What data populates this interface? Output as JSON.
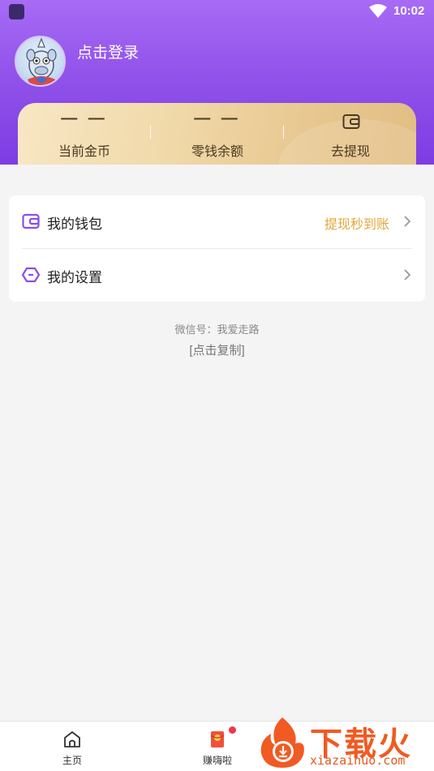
{
  "status_bar": {
    "time": "10:02"
  },
  "profile": {
    "login_text": "点击登录"
  },
  "stats": [
    {
      "value": "— —",
      "label": "当前金币"
    },
    {
      "value": "— —",
      "label": "零钱余额"
    },
    {
      "label": "去提现",
      "icon": "wallet-icon"
    }
  ],
  "menu": [
    {
      "label": "我的钱包",
      "extra": "提现秒到账",
      "icon": "wallet-icon"
    },
    {
      "label": "我的设置",
      "extra": "",
      "icon": "settings-icon"
    }
  ],
  "wechat": {
    "text": "微信号：我爱走路",
    "copy": "[点击复制]"
  },
  "tabs": [
    {
      "label": "主页",
      "icon": "home-icon"
    },
    {
      "label": "赚嗨啦",
      "icon": "red-envelope-icon"
    }
  ],
  "watermark": {
    "text": "下载火",
    "url": "xiazaihuo.com"
  },
  "colors": {
    "header": "#9153ea",
    "gold": "#f0d8a8",
    "accent_text": "#e3a83b",
    "menu_icon": "#8a4fe8"
  }
}
